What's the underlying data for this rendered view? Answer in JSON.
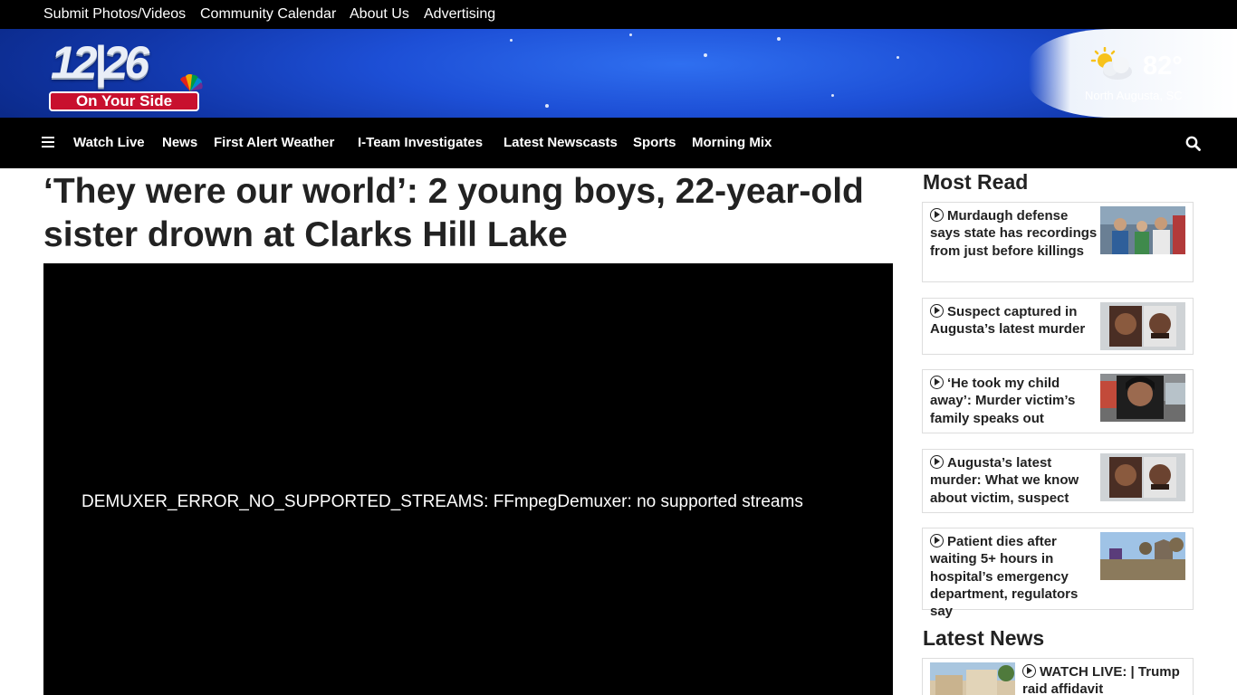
{
  "util_links": [
    "Submit Photos/Videos",
    "Community Calendar",
    "About Us",
    "Advertising"
  ],
  "logo": {
    "number": "12|26",
    "tagline": "On Your Side"
  },
  "weather": {
    "icon": "partly-cloudy-icon",
    "temp": "82°",
    "location": "North Augusta, SC"
  },
  "nav": {
    "menu_icon": "hamburger-menu-icon",
    "items": [
      "Watch Live",
      "News",
      "First Alert Weather",
      "I-Team Investigates",
      "Latest Newscasts",
      "Sports",
      "Morning Mix"
    ],
    "search_icon": "search-icon"
  },
  "article": {
    "headline": "‘They were our world’: 2 young boys, 22-year-old sister drown at Clarks Hill Lake",
    "video_error": "DEMUXER_ERROR_NO_SUPPORTED_STREAMS: FFmpegDemuxer: no supported streams"
  },
  "most_read": {
    "title": "Most Read",
    "items": [
      {
        "title": "Murdaugh defense says state has recordings from just before killings"
      },
      {
        "title": "Suspect captured in Augusta’s latest murder"
      },
      {
        "title": "‘He took my child away’: Murder victim’s family speaks out"
      },
      {
        "title": "Augusta’s latest murder: What we know about victim, suspect"
      },
      {
        "title": "Patient dies after waiting 5+ hours in hospital’s emergency department, regulators say"
      }
    ]
  },
  "latest_news": {
    "title": "Latest News",
    "items": [
      {
        "title": "WATCH LIVE: | Trump raid affidavit"
      }
    ]
  },
  "colors": {
    "header_blue": "#1d4fd6",
    "logo_red": "#c8102e",
    "nav_bg": "#000000"
  }
}
